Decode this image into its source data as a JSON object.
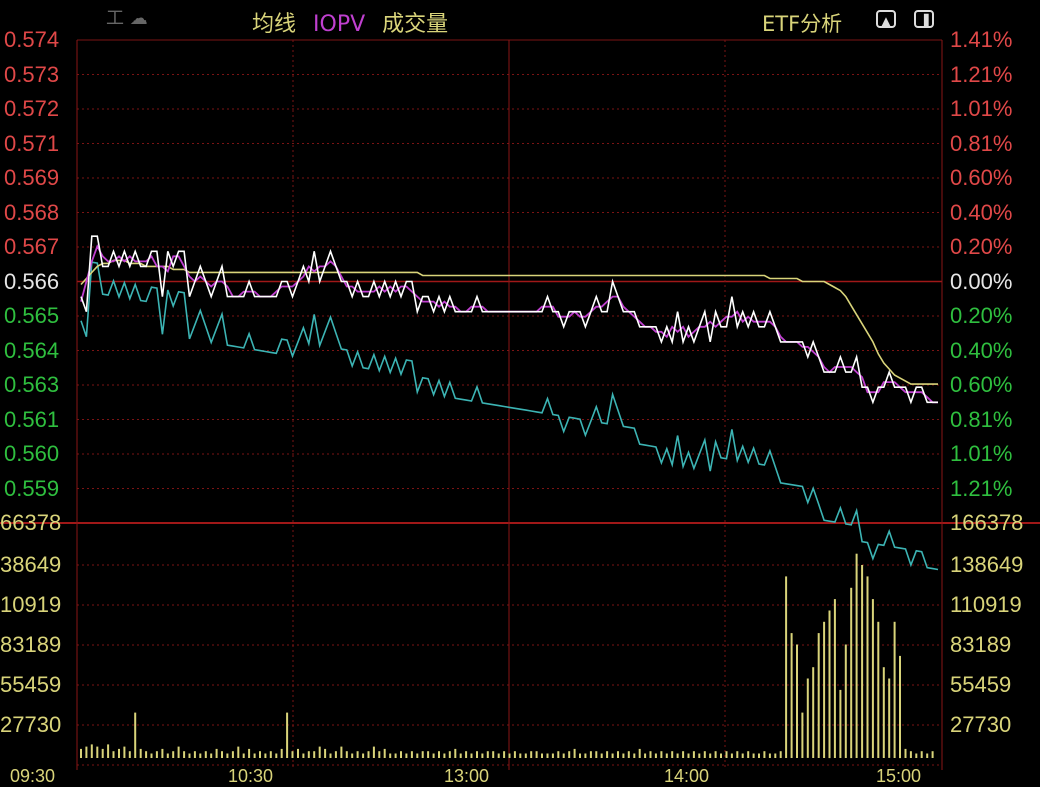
{
  "header": {
    "legend": [
      {
        "label": "均线",
        "color": "#d9d47a"
      },
      {
        "label": "IOPV",
        "color": "#c040d0"
      },
      {
        "label": "成交量",
        "color": "#d9d47a"
      }
    ],
    "etf_button": "ETF分析",
    "ghost_title": "工 ☁",
    "expand_icon": "arrow-up-icon",
    "panel_icon": "panel-toggle-icon"
  },
  "price_axis": {
    "left": [
      {
        "v": "0.574",
        "c": "#e04848"
      },
      {
        "v": "0.573",
        "c": "#e04848"
      },
      {
        "v": "0.572",
        "c": "#e04848"
      },
      {
        "v": "0.571",
        "c": "#e04848"
      },
      {
        "v": "0.569",
        "c": "#e04848"
      },
      {
        "v": "0.568",
        "c": "#e04848"
      },
      {
        "v": "0.567",
        "c": "#e04848"
      },
      {
        "v": "0.566",
        "c": "#e6e6e6"
      },
      {
        "v": "0.565",
        "c": "#2fbf3f"
      },
      {
        "v": "0.564",
        "c": "#2fbf3f"
      },
      {
        "v": "0.563",
        "c": "#2fbf3f"
      },
      {
        "v": "0.561",
        "c": "#2fbf3f"
      },
      {
        "v": "0.560",
        "c": "#2fbf3f"
      },
      {
        "v": "0.559",
        "c": "#2fbf3f"
      }
    ],
    "right": [
      {
        "v": "1.41%",
        "c": "#e04848"
      },
      {
        "v": "1.21%",
        "c": "#e04848"
      },
      {
        "v": "1.01%",
        "c": "#e04848"
      },
      {
        "v": "0.81%",
        "c": "#e04848"
      },
      {
        "v": "0.60%",
        "c": "#e04848"
      },
      {
        "v": "0.40%",
        "c": "#e04848"
      },
      {
        "v": "0.20%",
        "c": "#e04848"
      },
      {
        "v": "0.00%",
        "c": "#e6e6e6"
      },
      {
        "v": "0.20%",
        "c": "#2fbf3f"
      },
      {
        "v": "0.40%",
        "c": "#2fbf3f"
      },
      {
        "v": "0.60%",
        "c": "#2fbf3f"
      },
      {
        "v": "0.81%",
        "c": "#2fbf3f"
      },
      {
        "v": "1.01%",
        "c": "#2fbf3f"
      },
      {
        "v": "1.21%",
        "c": "#2fbf3f"
      }
    ]
  },
  "volume_axis": {
    "left": [
      "66378",
      "38649",
      "10919",
      "83189",
      "55459",
      "27730"
    ],
    "right": [
      "166378",
      "138649",
      "110919",
      "83189",
      "55459",
      "27730"
    ]
  },
  "time_axis": [
    "09:30",
    "10:30",
    "13:00",
    "14:00",
    "15:00"
  ],
  "colors": {
    "price": "#ffffff",
    "avg": "#d9d47a",
    "iopv": "#c040d0",
    "index": "#3cb4b4",
    "volume": "#d9d47a",
    "grid": "#7a1414"
  },
  "chart_data": {
    "type": "line",
    "ylim": [
      0.5585,
      0.5745
    ],
    "price": [
      0.566,
      0.5655,
      0.568,
      0.568,
      0.567,
      0.567,
      0.5675,
      0.567,
      0.5675,
      0.567,
      0.5675,
      0.567,
      0.567,
      0.5675,
      0.5675,
      0.566,
      0.5675,
      0.567,
      0.5675,
      0.5675,
      0.566,
      0.5665,
      0.567,
      0.5665,
      0.566,
      0.5665,
      0.567,
      0.566,
      0.566,
      0.566,
      0.566,
      0.5665,
      0.566,
      0.566,
      0.566,
      0.566,
      0.566,
      0.5665,
      0.5665,
      0.566,
      0.5665,
      0.567,
      0.5665,
      0.5675,
      0.5665,
      0.567,
      0.5675,
      0.567,
      0.5665,
      0.5665,
      0.566,
      0.5665,
      0.566,
      0.566,
      0.5665,
      0.566,
      0.5665,
      0.566,
      0.5665,
      0.566,
      0.5665,
      0.5665,
      0.5655,
      0.566,
      0.566,
      0.5655,
      0.566,
      0.5655,
      0.566,
      0.5655,
      0.5655,
      0.5655,
      0.5655,
      0.566,
      0.5655,
      0.5655,
      0.5655,
      0.5655,
      0.5655,
      0.5655,
      0.5655,
      0.5655,
      0.5655,
      0.5655,
      0.5655,
      0.5655,
      0.566,
      0.5655,
      0.5655,
      0.565,
      0.5655,
      0.5655,
      0.5655,
      0.565,
      0.5655,
      0.566,
      0.5655,
      0.5655,
      0.5665,
      0.566,
      0.5655,
      0.5655,
      0.5655,
      0.565,
      0.565,
      0.565,
      0.565,
      0.5645,
      0.565,
      0.5645,
      0.5655,
      0.5645,
      0.565,
      0.5645,
      0.565,
      0.5655,
      0.5645,
      0.5655,
      0.565,
      0.565,
      0.566,
      0.565,
      0.5655,
      0.565,
      0.5655,
      0.565,
      0.565,
      0.5655,
      0.565,
      0.5645,
      0.5645,
      0.5645,
      0.5645,
      0.5645,
      0.564,
      0.5645,
      0.564,
      0.5635,
      0.5635,
      0.5635,
      0.564,
      0.5635,
      0.5635,
      0.564,
      0.563,
      0.563,
      0.5625,
      0.563,
      0.563,
      0.5635,
      0.563,
      0.563,
      0.563,
      0.5625,
      0.563,
      0.563,
      0.5625,
      0.5625,
      0.5625
    ],
    "avg": [
      0.5664,
      0.5666,
      0.5668,
      0.567,
      0.5671,
      0.5671,
      0.5672,
      0.5672,
      0.5672,
      0.5671,
      0.5671,
      0.5671,
      0.567,
      0.567,
      0.567,
      0.567,
      0.567,
      0.5669,
      0.5669,
      0.5669,
      0.5668,
      0.5668,
      0.5668,
      0.5668,
      0.5668,
      0.5668,
      0.5668,
      0.5668,
      0.5668,
      0.5668,
      0.5668,
      0.5668,
      0.5668,
      0.5668,
      0.5668,
      0.5668,
      0.5668,
      0.5668,
      0.5668,
      0.5668,
      0.5668,
      0.5668,
      0.5668,
      0.5668,
      0.5668,
      0.5668,
      0.5668,
      0.5668,
      0.5668,
      0.5668,
      0.5668,
      0.5668,
      0.5668,
      0.5668,
      0.5668,
      0.5668,
      0.5668,
      0.5668,
      0.5668,
      0.5668,
      0.5668,
      0.5668,
      0.5668,
      0.5667,
      0.5667,
      0.5667,
      0.5667,
      0.5667,
      0.5667,
      0.5667,
      0.5667,
      0.5667,
      0.5667,
      0.5667,
      0.5667,
      0.5667,
      0.5667,
      0.5667,
      0.5667,
      0.5667,
      0.5667,
      0.5667,
      0.5667,
      0.5667,
      0.5667,
      0.5667,
      0.5667,
      0.5667,
      0.5667,
      0.5667,
      0.5667,
      0.5667,
      0.5667,
      0.5667,
      0.5667,
      0.5667,
      0.5667,
      0.5667,
      0.5667,
      0.5667,
      0.5667,
      0.5667,
      0.5667,
      0.5667,
      0.5667,
      0.5667,
      0.5667,
      0.5667,
      0.5667,
      0.5667,
      0.5667,
      0.5667,
      0.5667,
      0.5667,
      0.5667,
      0.5667,
      0.5667,
      0.5667,
      0.5667,
      0.5667,
      0.5667,
      0.5667,
      0.5667,
      0.5667,
      0.5667,
      0.5667,
      0.5667,
      0.5666,
      0.5666,
      0.5666,
      0.5666,
      0.5666,
      0.5666,
      0.5665,
      0.5665,
      0.5665,
      0.5665,
      0.5665,
      0.5664,
      0.5663,
      0.5662,
      0.566,
      0.5657,
      0.5654,
      0.5651,
      0.5648,
      0.5645,
      0.5641,
      0.5638,
      0.5636,
      0.5634,
      0.5633,
      0.5632,
      0.5631,
      0.5631,
      0.5631,
      0.5631,
      0.5631,
      0.5631
    ],
    "volume": [
      4,
      5,
      6,
      5,
      4,
      6,
      3,
      4,
      5,
      3,
      20,
      4,
      3,
      2,
      3,
      4,
      2,
      3,
      5,
      3,
      2,
      3,
      2,
      3,
      2,
      4,
      3,
      2,
      3,
      5,
      2,
      4,
      2,
      3,
      2,
      3,
      2,
      4,
      20,
      3,
      4,
      2,
      3,
      3,
      5,
      4,
      2,
      3,
      5,
      3,
      2,
      3,
      2,
      3,
      5,
      3,
      4,
      2,
      2,
      3,
      2,
      3,
      2,
      3,
      3,
      2,
      3,
      2,
      3,
      4,
      2,
      3,
      2,
      3,
      2,
      3,
      3,
      2,
      3,
      2,
      3,
      2,
      2,
      3,
      3,
      2,
      2,
      2,
      3,
      2,
      3,
      4,
      2,
      2,
      3,
      3,
      2,
      3,
      2,
      3,
      2,
      3,
      2,
      4,
      2,
      3,
      2,
      3,
      2,
      3,
      2,
      3,
      2,
      3,
      2,
      3,
      2,
      3,
      2,
      3,
      2,
      3,
      2,
      3,
      2,
      2,
      3,
      2,
      2,
      3,
      80,
      55,
      50,
      20,
      35,
      40,
      55,
      60,
      65,
      70,
      30,
      50,
      75,
      90,
      85,
      80,
      70,
      60,
      40,
      35,
      60,
      45,
      4,
      3,
      2,
      3,
      2,
      3
    ],
    "volume_max": 166378
  }
}
